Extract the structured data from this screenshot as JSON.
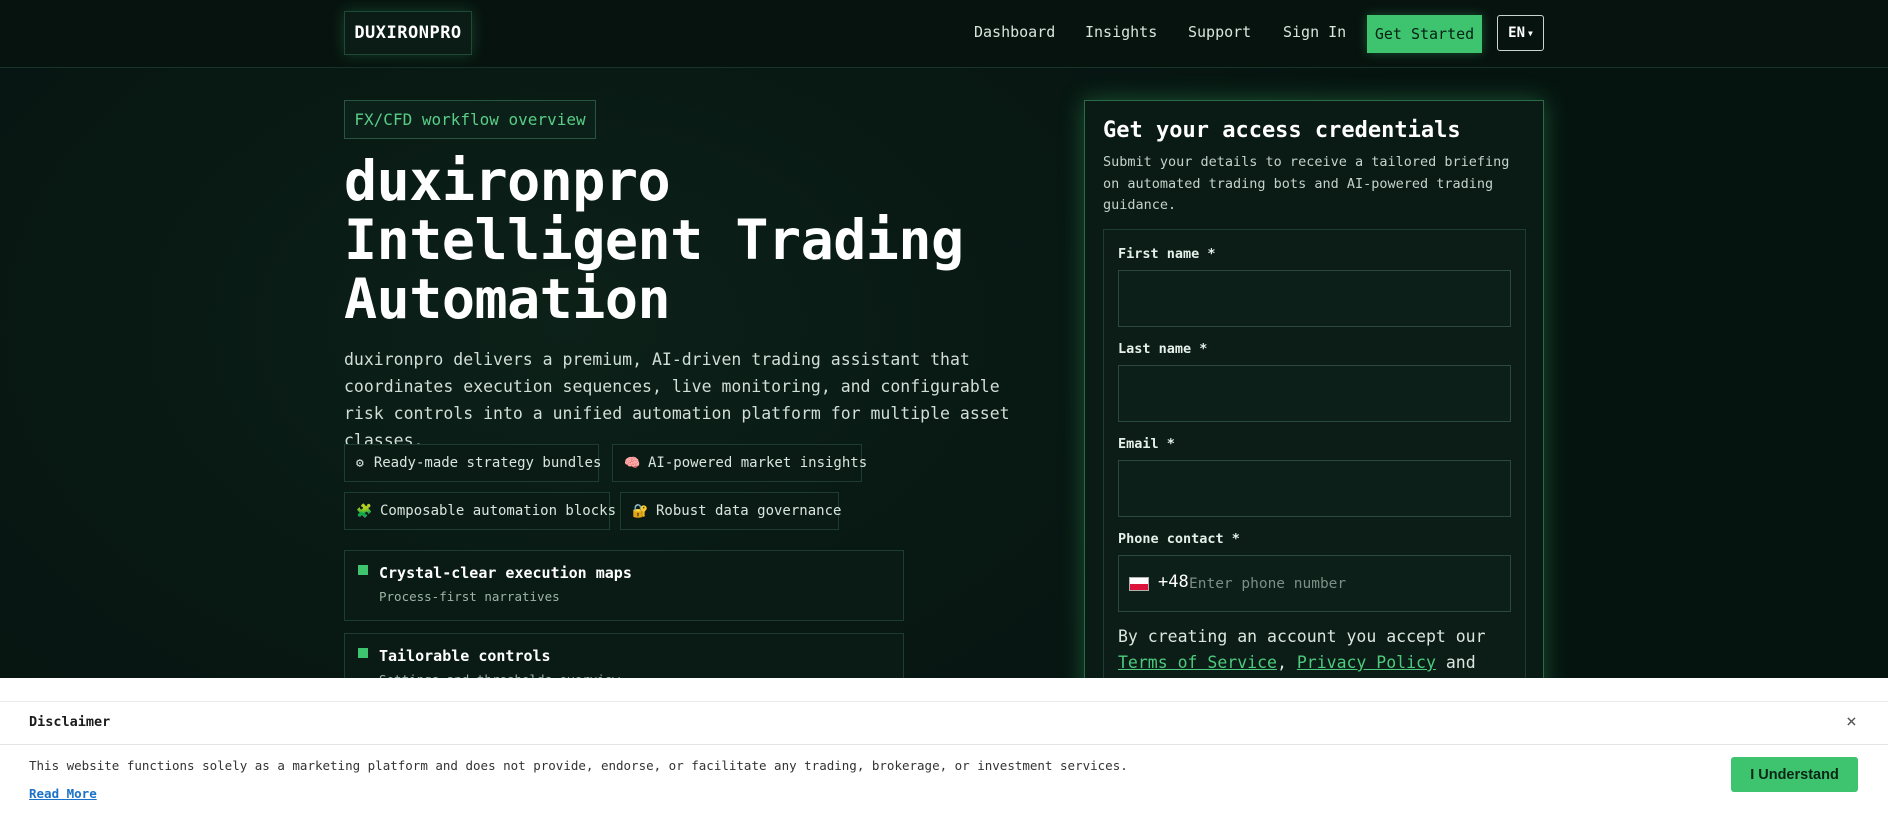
{
  "nav": {
    "logo": "DUXIRONPRO",
    "links": [
      "Dashboard",
      "Insights",
      "Support",
      "Sign In"
    ],
    "cta": "Get Started",
    "lang": "EN"
  },
  "hero": {
    "tag": "FX/CFD workflow overview",
    "title_lines": [
      "duxironpro",
      "Intelligent Trading",
      "Automation"
    ],
    "description": "duxironpro delivers a premium, AI-driven trading assistant that coordinates execution sequences, live monitoring, and configurable risk controls into a unified automation platform for multiple asset classes.",
    "chips": [
      {
        "icon": "gear-icon",
        "glyph": "⚙",
        "label": "Ready-made strategy bundles"
      },
      {
        "icon": "brain-icon",
        "glyph": "🧠",
        "label": "AI-powered market insights"
      },
      {
        "icon": "puzzle-icon",
        "glyph": "🧩",
        "label": "Composable automation blocks"
      },
      {
        "icon": "lock-icon",
        "glyph": "🔐",
        "label": "Robust data governance"
      }
    ],
    "features": [
      {
        "title": "Crystal-clear execution maps",
        "subtitle": "Process-first narratives"
      },
      {
        "title": "Tailorable controls",
        "subtitle": "Settings and thresholds overview"
      }
    ]
  },
  "form": {
    "title": "Get your access credentials",
    "subtitle": "Submit your details to receive a tailored briefing on automated trading bots and AI-powered trading guidance.",
    "first_name_label": "First name *",
    "last_name_label": "Last name *",
    "email_label": "Email *",
    "phone_label": "Phone contact *",
    "phone_code": "+48",
    "phone_placeholder": "Enter phone number",
    "terms_prefix": "By creating an account you accept our",
    "terms_link": "Terms of Service",
    "privacy_link": "Privacy Policy",
    "terms_and": "and"
  },
  "disclaimer": {
    "title": "Disclaimer",
    "close": "×",
    "text": "This website functions solely as a marketing platform and does not provide, endorse, or facilitate any trading, brokerage, or investment services.",
    "read_more": "Read More",
    "button": "I Understand"
  },
  "colors": {
    "accent": "#3ec46f",
    "background": "#061410",
    "link": "#1a73c9"
  }
}
